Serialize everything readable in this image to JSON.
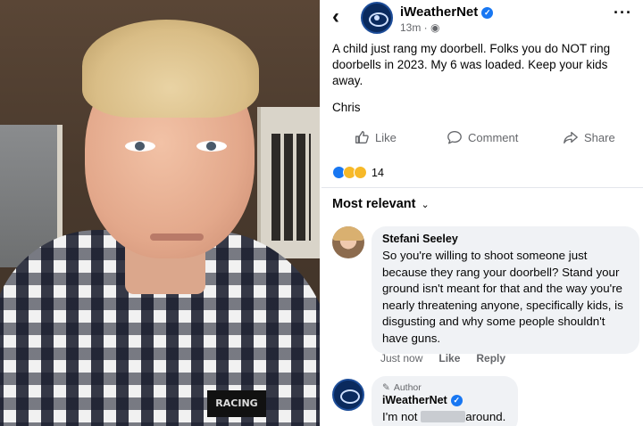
{
  "photo": {
    "badge_text": "RACING"
  },
  "header": {
    "back_icon": "chevron-left-icon",
    "page_name": "iWeatherNet",
    "post_time": "13m · ◉",
    "more_icon": "more-horizontal-icon"
  },
  "post": {
    "text": "A child just rang my doorbell. Folks you do NOT ring doorbells in 2023. My 6 was loaded. Keep your kids away.",
    "signature": "Chris"
  },
  "actions": {
    "like_label": "Like",
    "comment_label": "Comment",
    "share_label": "Share"
  },
  "reactions": {
    "icons": [
      "like-reaction",
      "haha-reaction",
      "wow-reaction"
    ],
    "count": "14"
  },
  "comments_sort": {
    "label": "Most relevant"
  },
  "comments": [
    {
      "author": "Stefani Seeley",
      "text": "So you're willing to shoot someone just because they rang your doorbell? Stand your ground isn't meant for that and the way you're nearly threatening anyone, specifically kids, is disgusting and why some people shouldn't have guns.",
      "time": "Just now",
      "like_label": "Like",
      "reply_label": "Reply"
    },
    {
      "badge": "Author",
      "author": "iWeatherNet",
      "text_before": "I'm not",
      "text_after": "around."
    }
  ],
  "colors": {
    "accent": "#1877f2",
    "text_secondary": "#65676b",
    "bubble": "#f0f2f5"
  }
}
